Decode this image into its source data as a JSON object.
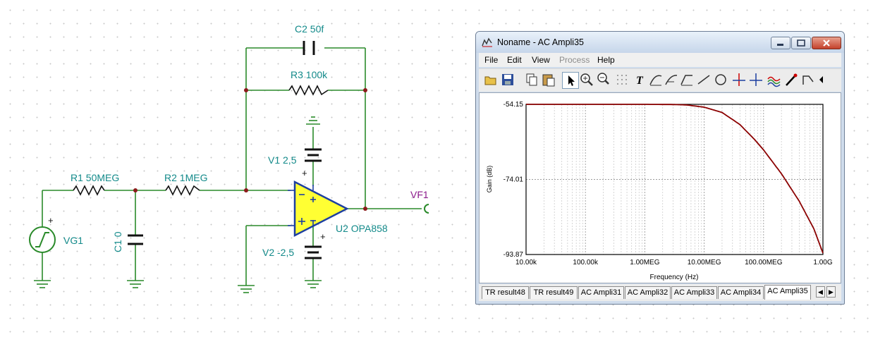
{
  "schematic": {
    "c2_label": "C2 50f",
    "r3_label": "R3 100k",
    "v1_label": "V1 2,5",
    "r1_label": "R1 50MEG",
    "r2_label": "R2 1MEG",
    "vf1_label": "VF1",
    "vg1_label": "VG1",
    "c1_label": "C1 0",
    "u2_label": "U2 OPA858",
    "v2_label": "V2 -2,5"
  },
  "window": {
    "title": "Noname - AC Ampli35",
    "menu": [
      "File",
      "Edit",
      "View",
      "Process",
      "Help"
    ],
    "toolbar_icons": [
      "open-icon",
      "save-icon",
      "copy-icon",
      "paste-icon",
      "pointer-icon",
      "zoom-in-icon",
      "zoom-out-icon",
      "grid-icon",
      "text-icon",
      "curve-a-icon",
      "curve-b-icon",
      "curve-c-icon",
      "line-icon",
      "circle-icon",
      "cursor-a-icon",
      "cursor-b-icon",
      "waves-icon",
      "probe-icon",
      "step-icon"
    ],
    "tabs": [
      "TR result48",
      "TR result49",
      "AC Ampli31",
      "AC Ampli32",
      "AC Ampli33",
      "AC Ampli34",
      "AC Ampli35"
    ],
    "active_tab": "AC Ampli35"
  },
  "chart_data": {
    "type": "line",
    "xlabel": "Frequency (Hz)",
    "ylabel": "Gain (dB)",
    "x_scale": "log",
    "xlim": [
      10000,
      1000000000
    ],
    "ylim": [
      -93.87,
      -54.15
    ],
    "x_tick_labels": [
      "10.00k",
      "100.00k",
      "1.00MEG",
      "10.00MEG",
      "100.00MEG",
      "1.00G"
    ],
    "y_tick_labels": [
      "-54.15",
      "-74.01",
      "-93.87"
    ],
    "grid": true,
    "series_color": "#8b0000",
    "series": [
      {
        "x": [
          10000,
          100000,
          1000000,
          3000000,
          5000000,
          10000000,
          20000000,
          40000000,
          70000000,
          100000000,
          200000000,
          400000000,
          700000000,
          1000000000
        ],
        "y": [
          -54.15,
          -54.15,
          -54.15,
          -54.2,
          -54.3,
          -54.9,
          -56.3,
          -59.5,
          -63.4,
          -66.2,
          -72.5,
          -79.8,
          -87.0,
          -93.5
        ]
      }
    ]
  }
}
